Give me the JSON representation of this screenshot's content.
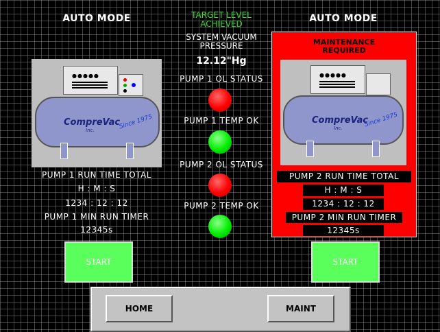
{
  "pump1": {
    "mode": "AUTO MODE",
    "run_time_total_label": "PUMP 1 RUN TIME TOTAL",
    "hms_label": "H : M : S",
    "run_time_value": "1234 : 12 : 12",
    "min_run_timer_label": "PUMP 1 MIN RUN TIMER",
    "min_run_timer_value": "12345s",
    "start_label": "START",
    "logo_text": "CompreVac",
    "logo_sub": "Inc.",
    "logo_since": "Since 1975"
  },
  "pump2": {
    "mode": "AUTO MODE",
    "alert": "MAINTENANCE REQUIRED",
    "run_time_total_label": "PUMP 2 RUN TIME TOTAL",
    "hms_label": "H : M : S",
    "run_time_value": "1234 : 12 : 12",
    "min_run_timer_label": "PUMP 2 MIN RUN TIMER",
    "min_run_timer_value": "12345s",
    "start_label": "START",
    "logo_text": "CompreVac",
    "logo_sub": "Inc.",
    "logo_since": "Since 1975"
  },
  "center": {
    "target_status": "TARGET LEVEL ACHIEVED",
    "vacuum_label": "SYSTEM VACUUM PRESSURE",
    "vacuum_value": "12.12\"Hg",
    "indicators": [
      {
        "label": "PUMP 1 OL STATUS",
        "state": "red"
      },
      {
        "label": "PUMP 1 TEMP OK",
        "state": "green"
      },
      {
        "label": "PUMP 2 OL STATUS",
        "state": "red"
      },
      {
        "label": "PUMP 2 TEMP OK",
        "state": "green"
      }
    ]
  },
  "nav": {
    "home_label": "HOME",
    "maint_label": "MAINT"
  },
  "colors": {
    "alarm": "#ff0000",
    "status_green": "#00ee00",
    "start_green": "#5bff5b",
    "tank": "#8f96cc",
    "target_text": "#33dd33"
  }
}
